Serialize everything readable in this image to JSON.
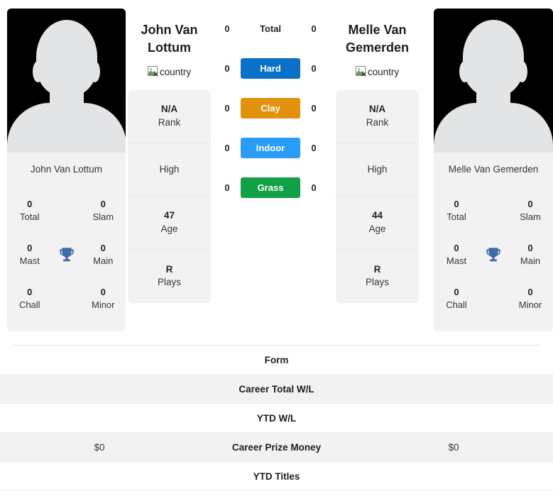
{
  "players": {
    "left": {
      "name": "John Van Lottum",
      "short_name": "John Van Lottum",
      "country_alt": "country",
      "info": [
        {
          "value": "N/A",
          "label": "Rank"
        },
        {
          "value": "",
          "label": "High"
        },
        {
          "value": "47",
          "label": "Age"
        },
        {
          "value": "R",
          "label": "Plays"
        }
      ],
      "titles": [
        {
          "value": "0",
          "label": "Total"
        },
        {
          "value": "0",
          "label": "Slam"
        },
        {
          "value": "0",
          "label": "Mast"
        },
        {
          "value": "0",
          "label": "Main"
        },
        {
          "value": "0",
          "label": "Chall"
        },
        {
          "value": "0",
          "label": "Minor"
        }
      ]
    },
    "right": {
      "name": "Melle Van Gemerden",
      "short_name": "Melle Van Gemerden",
      "country_alt": "country",
      "info": [
        {
          "value": "N/A",
          "label": "Rank"
        },
        {
          "value": "",
          "label": "High"
        },
        {
          "value": "44",
          "label": "Age"
        },
        {
          "value": "R",
          "label": "Plays"
        }
      ],
      "titles": [
        {
          "value": "0",
          "label": "Total"
        },
        {
          "value": "0",
          "label": "Slam"
        },
        {
          "value": "0",
          "label": "Mast"
        },
        {
          "value": "0",
          "label": "Main"
        },
        {
          "value": "0",
          "label": "Chall"
        },
        {
          "value": "0",
          "label": "Minor"
        }
      ]
    }
  },
  "surfaces": [
    {
      "label": "Total",
      "left": "0",
      "right": "0",
      "color": "transparent",
      "plain": true
    },
    {
      "label": "Hard",
      "left": "0",
      "right": "0",
      "color": "#0a70c8",
      "plain": false
    },
    {
      "label": "Clay",
      "left": "0",
      "right": "0",
      "color": "#e0920d",
      "plain": false
    },
    {
      "label": "Indoor",
      "left": "0",
      "right": "0",
      "color": "#2b9cf5",
      "plain": false
    },
    {
      "label": "Grass",
      "left": "0",
      "right": "0",
      "color": "#11a047",
      "plain": false
    }
  ],
  "comparison_rows": [
    {
      "left": "",
      "label": "Form",
      "right": ""
    },
    {
      "left": "",
      "label": "Career Total W/L",
      "right": ""
    },
    {
      "left": "",
      "label": "YTD W/L",
      "right": ""
    },
    {
      "left": "$0",
      "label": "Career Prize Money",
      "right": "$0"
    },
    {
      "left": "",
      "label": "YTD Titles",
      "right": ""
    }
  ],
  "icons": {
    "trophy": "trophy-icon",
    "broken_image": "broken-image-icon"
  },
  "colors": {
    "hard": "#0a70c8",
    "clay": "#e0920d",
    "indoor": "#2b9cf5",
    "grass": "#11a047",
    "trophy": "#3b6ea8",
    "card_bg": "#f2f2f2",
    "avatar_bg": "#000000"
  }
}
